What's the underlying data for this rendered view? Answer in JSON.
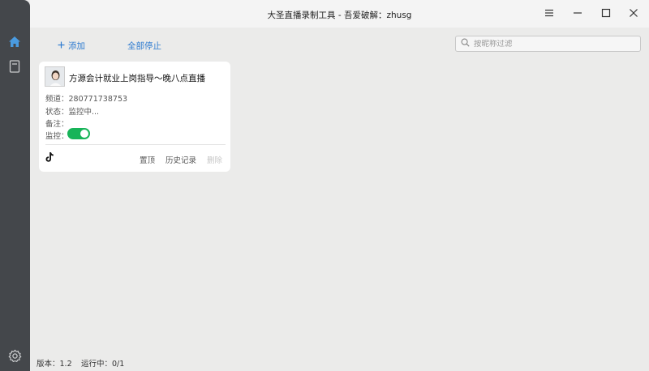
{
  "window": {
    "title": "大圣直播录制工具 - 吾爱破解：zhusg"
  },
  "sidebar": {
    "items": [
      {
        "name": "home",
        "icon": "home-icon"
      },
      {
        "name": "records",
        "icon": "book-icon"
      },
      {
        "name": "settings",
        "icon": "gear-icon"
      }
    ]
  },
  "toolbar": {
    "add_label": "添加",
    "stop_all_label": "全部停止",
    "search_placeholder": "按昵称过滤"
  },
  "cards": [
    {
      "title": "方源会计就业上岗指导～晚八点直播",
      "channel": "频道：280771738753",
      "status": "状态：监控中...",
      "note": "备注：",
      "monitor_label": "监控：",
      "monitor_on": true,
      "platform_icon": "tiktok-icon",
      "actions": {
        "pin": "置顶",
        "history": "历史记录",
        "delete": "删除"
      }
    }
  ],
  "statusbar": {
    "version": "版本：1.2",
    "running": "运行中：0/1"
  },
  "colors": {
    "accent": "#2e7bd0",
    "toggle_on": "#18b459",
    "sidebar_bg": "#44474b"
  }
}
